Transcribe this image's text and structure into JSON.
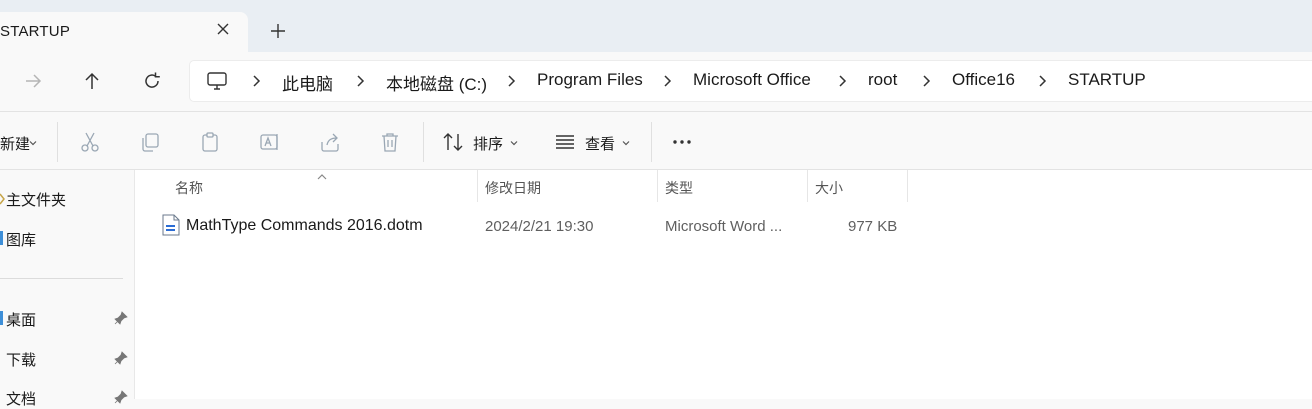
{
  "tab": {
    "title": "STARTUP"
  },
  "breadcrumb": [
    "此电脑",
    "本地磁盘 (C:)",
    "Program Files",
    "Microsoft Office",
    "root",
    "Office16",
    "STARTUP"
  ],
  "toolbar": {
    "new_label": "新建",
    "sort_label": "排序",
    "view_label": "查看"
  },
  "sidebar": {
    "items": [
      {
        "label": "主文件夹"
      },
      {
        "label": "图库"
      },
      {
        "label": "桌面"
      },
      {
        "label": "下载"
      },
      {
        "label": "文档"
      }
    ]
  },
  "columns": {
    "name": "名称",
    "modified": "修改日期",
    "type": "类型",
    "size": "大小"
  },
  "files": [
    {
      "name": "MathType Commands 2016.dotm",
      "modified": "2024/2/21 19:30",
      "type": "Microsoft Word ...",
      "size": "977 KB"
    }
  ],
  "colors": {
    "titlebar_bg": "#e9eef3",
    "window_bg": "#f9f9f9",
    "content_bg": "#ffffff",
    "word_icon": "#2b6cd4"
  }
}
